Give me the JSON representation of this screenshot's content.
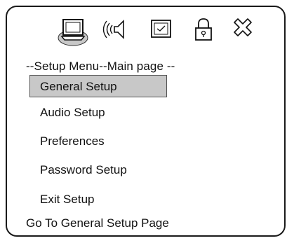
{
  "header": {
    "icons": [
      "general-setup-icon",
      "audio-setup-icon",
      "preferences-icon",
      "password-lock-icon",
      "exit-icon"
    ]
  },
  "title": "--Setup Menu--Main page --",
  "menu": {
    "items": [
      {
        "label": "General Setup",
        "selected": true
      },
      {
        "label": "Audio Setup",
        "selected": false
      },
      {
        "label": "Preferences",
        "selected": false
      },
      {
        "label": "Password Setup",
        "selected": false
      },
      {
        "label": "Exit Setup",
        "selected": false
      }
    ]
  },
  "status": "Go To General Setup Page",
  "colors": {
    "highlight": "#c8c8c8",
    "icon_selected_bg": "#c8c8c8",
    "border": "#1a1a1a"
  }
}
